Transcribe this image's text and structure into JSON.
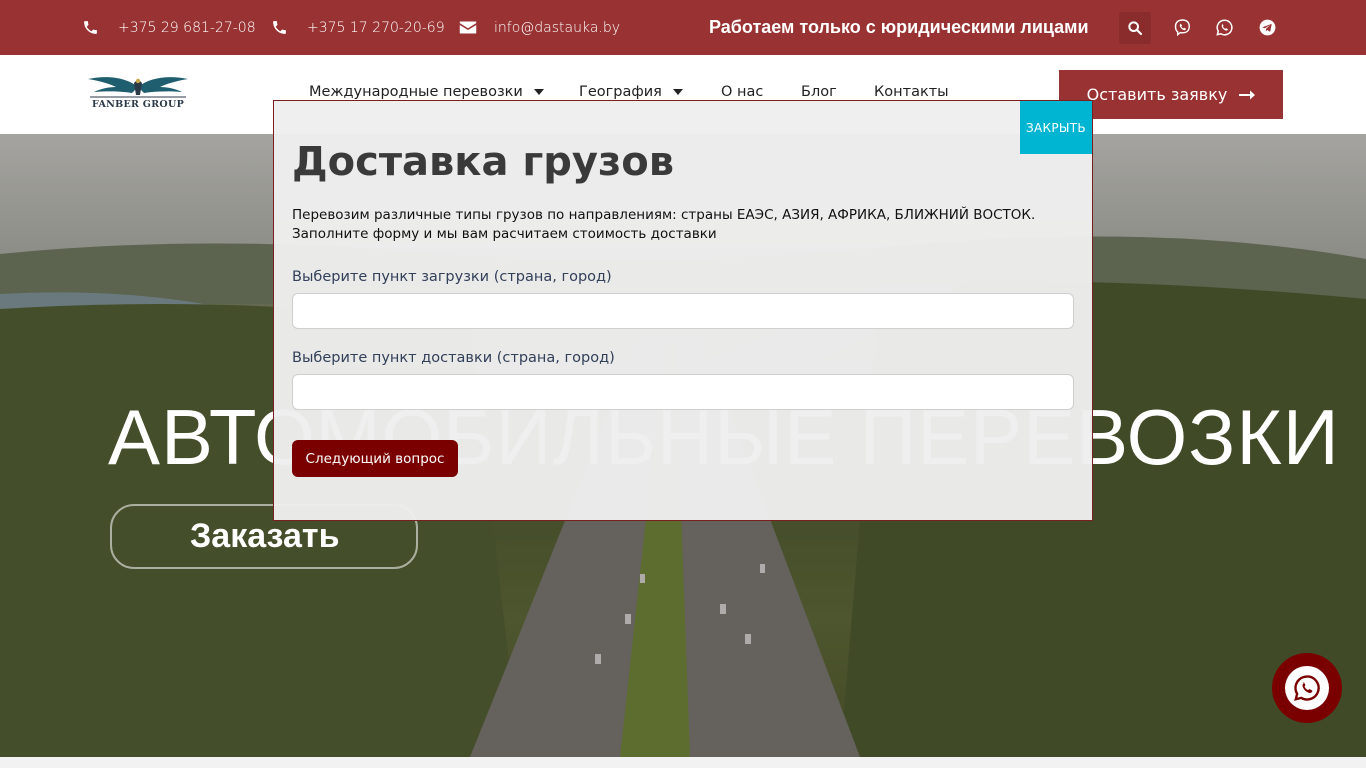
{
  "topbar": {
    "phone1": "+375 29 681-27-08",
    "phone2": "+375 17 270-20-69",
    "email": "info@dastauka.by",
    "notice": "Работаем только с юридическими лицами",
    "icons": [
      "phone-icon",
      "phone-icon",
      "envelope-icon",
      "search-icon",
      "viber-icon",
      "whatsapp-icon",
      "telegram-icon"
    ],
    "bg_color": "#993333"
  },
  "header": {
    "logo_text": "FANBER GROUP",
    "nav": [
      {
        "label": "Международные перевозки",
        "has_dropdown": true
      },
      {
        "label": "География",
        "has_dropdown": true
      },
      {
        "label": "О нас",
        "has_dropdown": false
      },
      {
        "label": "Блог",
        "has_dropdown": false
      },
      {
        "label": "Контакты",
        "has_dropdown": false
      }
    ],
    "cta_label": "Оставить заявку"
  },
  "hero": {
    "title": "АВТОМОБИЛЬНЫЕ ПЕРЕВОЗКИ",
    "button_label": "Заказать"
  },
  "modal": {
    "close_label": "ЗАКРЫТЬ",
    "title": "Доставка грузов",
    "description_line1": "Перевозим различные типы грузов по направлениям: страны ЕАЭС, АЗИЯ, АФРИКА, БЛИЖНИЙ ВОСТОК.",
    "description_line2": "Заполните форму и мы вам расчитаем стоимость доставки",
    "field1_label": "Выберите пункт загрузки (страна, город)",
    "field1_value": "",
    "field2_label": "Выберите пункт доставки (страна, город)",
    "field2_value": "",
    "next_label": "Следующий вопрос",
    "close_color": "#00b5d1",
    "button_color": "#7a0000"
  },
  "fab": {
    "icon": "whatsapp-icon"
  }
}
